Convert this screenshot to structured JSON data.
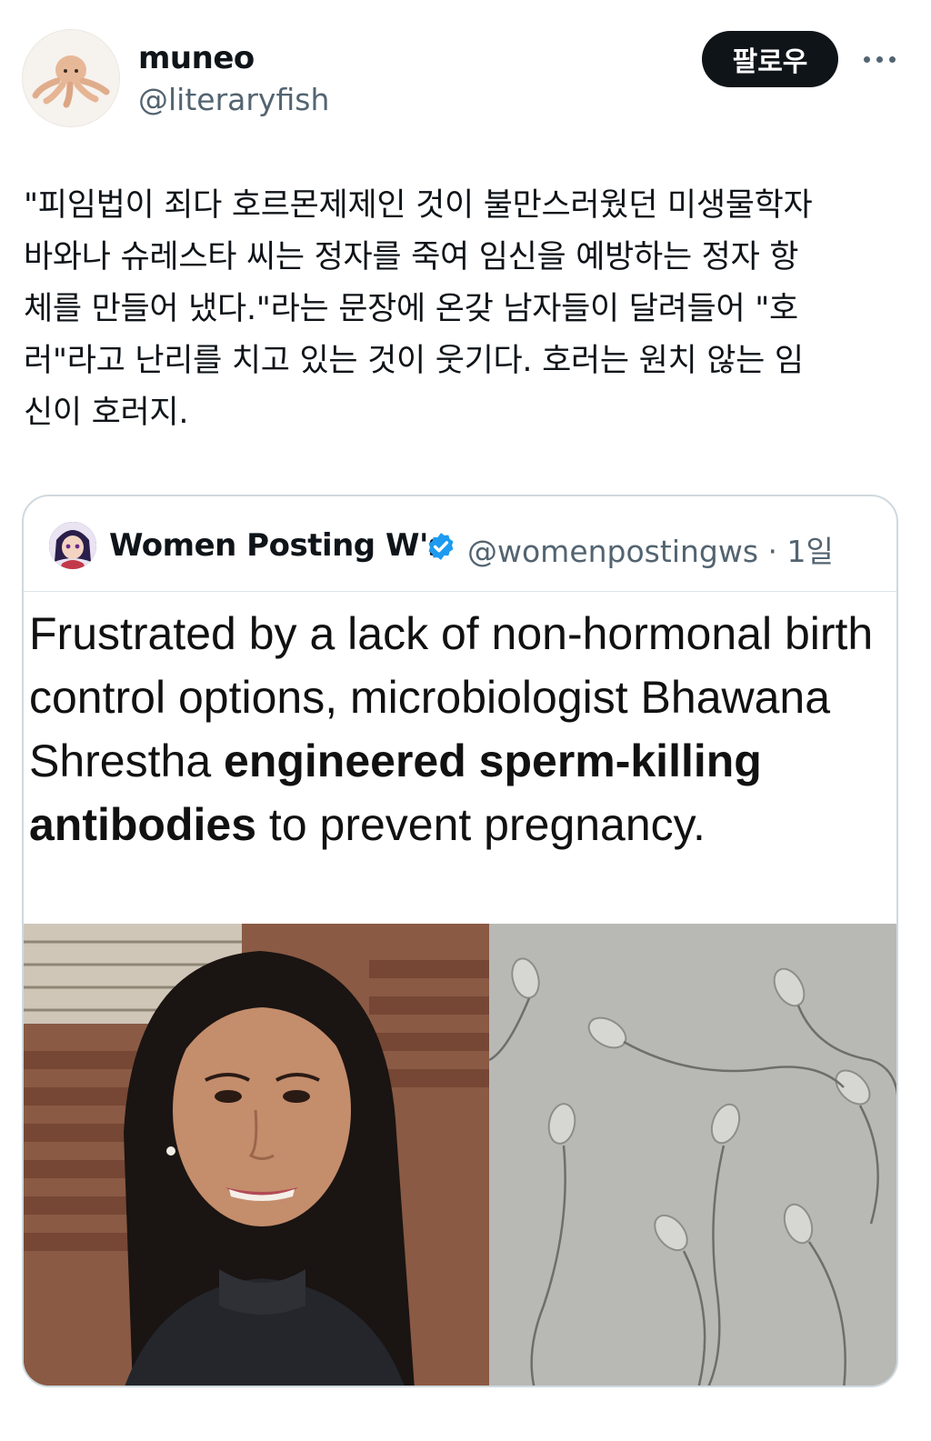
{
  "author": {
    "name": "muneo",
    "handle": "@literaryfish",
    "avatar_icon": "octopus-plush-icon"
  },
  "actions": {
    "follow_label": "팔로우",
    "more_icon": "more-horizontal-icon"
  },
  "tweet": {
    "text": "\"피임법이 죄다 호르몬제제인 것이 불만스러웠던 미생물학자\n바와나 슈레스타 씨는 정자를 죽여 임신을 예방하는 정자 항\n체를 만들어 냈다.\"라는 문장에 온갖 남자들이 달려들어 \"호\n러\"라고 난리를 치고 있는 것이 웃기다. 호러는 원치 않는 임\n신이 호러지."
  },
  "quoted": {
    "name": "Women Posting W's",
    "verified_icon": "verified-badge-icon",
    "handle_time": "@womenpostingws · 1일",
    "headline_regular_1": "Frustrated by a lack of non-hormonal birth control options, microbiologist Bhawana Shrestha ",
    "headline_bold": "engineered sperm-killing antibodies",
    "headline_regular_2": " to prevent pregnancy.",
    "photo_left": "portrait-photo",
    "photo_right": "sperm-microscopy-photo"
  },
  "colors": {
    "text": "#0f1419",
    "secondary": "#536471",
    "border": "#cfd9de",
    "verified": "#1d9bf0",
    "button_bg": "#0f1419"
  }
}
